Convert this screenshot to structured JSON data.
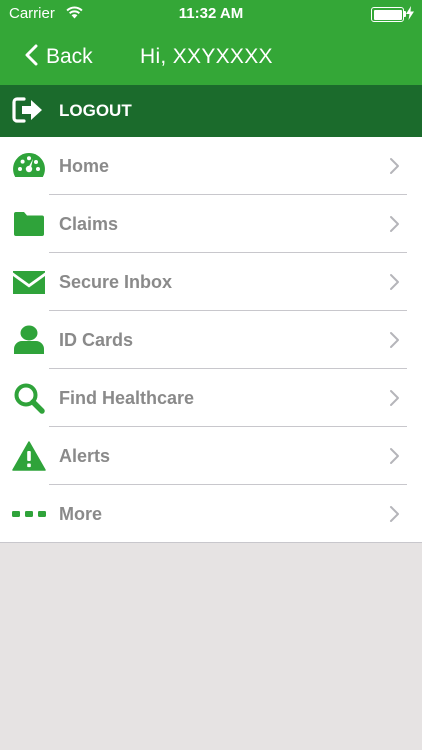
{
  "status_bar": {
    "carrier": "Carrier",
    "time": "11:32 AM"
  },
  "nav": {
    "back_label": "Back",
    "title": "Hi, XXYXXXX"
  },
  "logout": {
    "label": "LOGOUT",
    "icon": "logout-arrow-icon"
  },
  "menu": {
    "items": [
      {
        "label": "Home",
        "icon": "dashboard-gauge-icon"
      },
      {
        "label": "Claims",
        "icon": "folder-icon"
      },
      {
        "label": "Secure Inbox",
        "icon": "envelope-icon"
      },
      {
        "label": "ID Cards",
        "icon": "person-icon"
      },
      {
        "label": "Find Healthcare",
        "icon": "search-icon"
      },
      {
        "label": "Alerts",
        "icon": "warning-icon"
      },
      {
        "label": "More",
        "icon": "more-dots-icon"
      }
    ]
  },
  "colors": {
    "header_green": "#34a737",
    "logout_green": "#1b6b2c",
    "icon_green": "#2fa33a",
    "label_gray": "#8a8a8a",
    "background": "#e6e3e3"
  }
}
